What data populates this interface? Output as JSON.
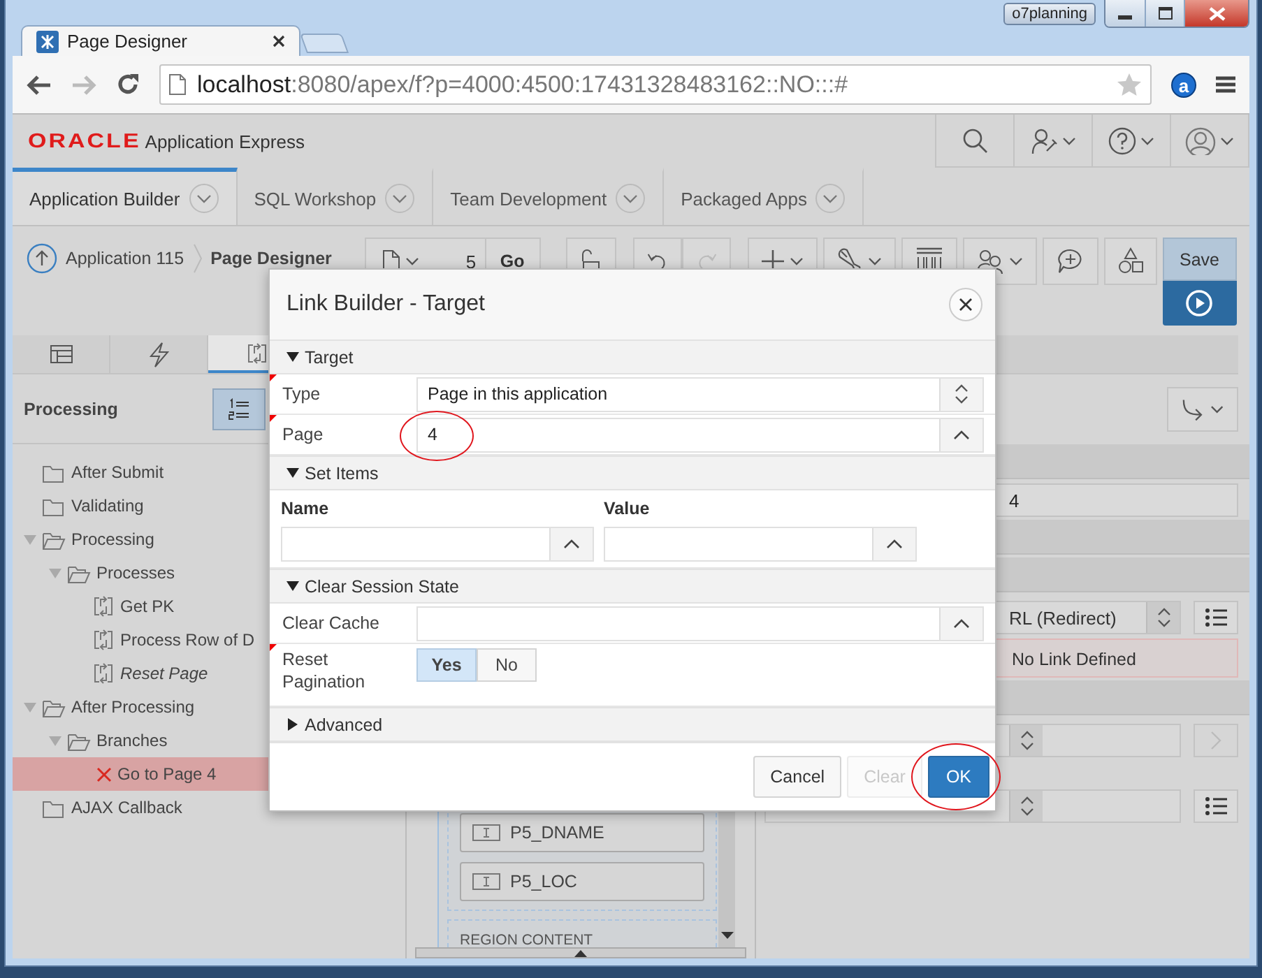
{
  "browser": {
    "tab_title": "Page Designer",
    "extension": "a",
    "user_badge": "o7planning",
    "address": {
      "host": "localhost",
      "path": ":8080/apex/f?p=4000:4500:17431328483162::NO:::#"
    }
  },
  "app_header": {
    "brand": "ORACLE",
    "product": "Application Express"
  },
  "nav_tabs": [
    {
      "label": "Application Builder",
      "selected": true
    },
    {
      "label": "SQL Workshop",
      "selected": false
    },
    {
      "label": "Team Development",
      "selected": false
    },
    {
      "label": "Packaged Apps",
      "selected": false
    }
  ],
  "breadcrumb": {
    "parent": "Application 115",
    "current": "Page Designer"
  },
  "page_selector": {
    "value": "5",
    "go": "Go"
  },
  "save_button": "Save",
  "left_panel": {
    "tabs": [
      {
        "kind": "layout",
        "selected": false
      },
      {
        "kind": "events",
        "selected": false
      },
      {
        "kind": "processing",
        "selected": true
      }
    ],
    "title": "Processing",
    "tree": [
      {
        "label": "After Submit",
        "kind": "folder",
        "selected": false
      },
      {
        "label": "Validating",
        "kind": "folder",
        "selected": false
      },
      {
        "label": "Processing",
        "kind": "folder",
        "expanded": true,
        "selected": false,
        "children": [
          {
            "label": "Processes",
            "kind": "folder",
            "expanded": true,
            "selected": false,
            "children": [
              {
                "label": "Get PK",
                "kind": "process",
                "italic": false,
                "selected": false
              },
              {
                "label": "Process Row of D",
                "kind": "process",
                "italic": false,
                "selected": false
              },
              {
                "label": "Reset Page",
                "kind": "process",
                "italic": true,
                "selected": false
              }
            ]
          }
        ]
      },
      {
        "label": "After Processing",
        "kind": "folder",
        "expanded": true,
        "selected": false,
        "children": [
          {
            "label": "Branches",
            "kind": "folder",
            "expanded": true,
            "selected": false,
            "children": [
              {
                "label": "Go to Page 4",
                "kind": "error",
                "selected": true
              }
            ]
          }
        ]
      },
      {
        "label": "AJAX Callback",
        "kind": "folder",
        "selected": false
      }
    ]
  },
  "layout": {
    "items": [
      "P5_DNAME",
      "P5_LOC"
    ],
    "region": "REGION CONTENT"
  },
  "right_panel": {
    "page_value": "4",
    "target_type": "RL (Redirect)",
    "link": "No Link Defined"
  },
  "dialog": {
    "title": "Link Builder - Target",
    "sections": [
      {
        "title": "Target",
        "expanded": true,
        "fields": [
          {
            "label": "Type",
            "kind": "select",
            "value": "Page in this application",
            "required": true,
            "highlight": false
          },
          {
            "label": "Page",
            "kind": "popup",
            "value": "4",
            "required": true,
            "highlight": true
          }
        ]
      },
      {
        "title": "Set Items",
        "expanded": true,
        "columns": [
          "Name",
          "Value"
        ]
      },
      {
        "title": "Clear Session State",
        "expanded": true,
        "fields": [
          {
            "label": "Clear Cache",
            "kind": "popup",
            "required": false,
            "highlight": false
          },
          {
            "label": "Reset Pagination",
            "kind": "toggle",
            "required": true,
            "highlight": false,
            "options": [
              {
                "label": "Yes",
                "selected": true
              },
              {
                "label": "No",
                "selected": false
              }
            ]
          }
        ]
      },
      {
        "title": "Advanced",
        "expanded": false
      }
    ],
    "buttons": [
      {
        "label": "Cancel",
        "kind": "default",
        "disabled": false,
        "highlight": false
      },
      {
        "label": "Clear",
        "kind": "default",
        "disabled": true,
        "highlight": false
      },
      {
        "label": "OK",
        "kind": "primary",
        "disabled": false,
        "highlight": true
      }
    ]
  }
}
